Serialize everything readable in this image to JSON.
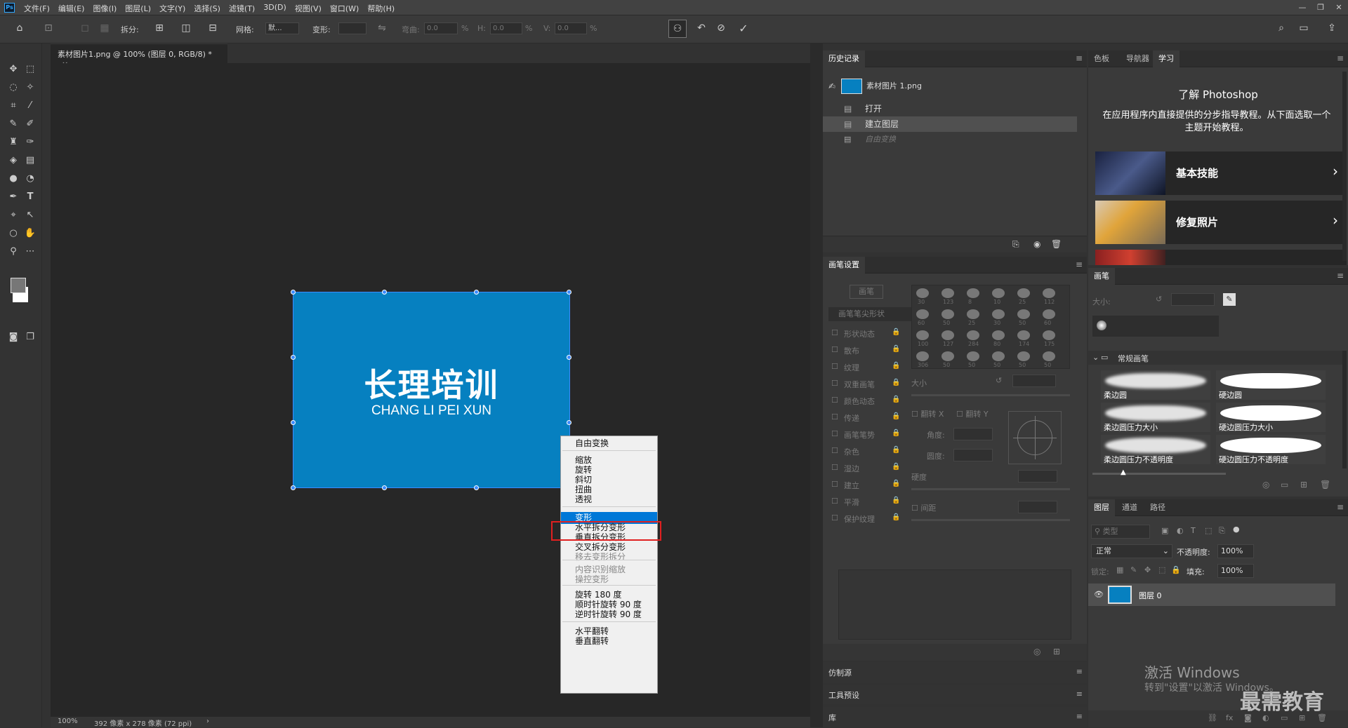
{
  "app": {
    "logo": "Ps"
  },
  "menubar": {
    "items": [
      "文件(F)",
      "编辑(E)",
      "图像(I)",
      "图层(L)",
      "文字(Y)",
      "选择(S)",
      "滤镜(T)",
      "3D(D)",
      "视图(V)",
      "窗口(W)",
      "帮助(H)"
    ],
    "window_controls": [
      "—",
      "❐",
      "✕"
    ]
  },
  "options": {
    "split_label": "拆分:",
    "grid_label": "网格:",
    "grid_value": "默...",
    "warp_label": "变形:",
    "bend_label": "弯曲:",
    "bend_value": "0.0",
    "bend_unit": "%",
    "h_label": "H:",
    "h_value": "0.0",
    "h_unit": "%",
    "v_label": "V:",
    "v_value": "0.0",
    "v_unit": "%"
  },
  "document": {
    "tab_title": "素材图片1.png @ 100% (图层 0, RGB/8) *",
    "tab_close": "×",
    "zoom": "100%",
    "doc_info": "392 像素 x 278 像素 (72 ppi)",
    "status_arrow": "›"
  },
  "artwork": {
    "headline": "长理培训",
    "subtitle": "CHANG LI PEI XUN",
    "color": "#0680c0"
  },
  "context_menu": {
    "items": [
      {
        "label": "自由变换",
        "disabled": false
      },
      {
        "label": "缩放",
        "disabled": false
      },
      {
        "label": "旋转",
        "disabled": false
      },
      {
        "label": "斜切",
        "disabled": false
      },
      {
        "label": "扭曲",
        "disabled": false
      },
      {
        "label": "透视",
        "disabled": false
      },
      {
        "label": "变形",
        "disabled": false,
        "selected": true
      },
      {
        "label": "水平拆分变形",
        "disabled": false
      },
      {
        "label": "垂直拆分变形",
        "disabled": false
      },
      {
        "label": "交叉拆分变形",
        "disabled": false
      },
      {
        "label": "移去变形拆分",
        "disabled": true
      },
      {
        "label": "内容识别缩放",
        "disabled": true
      },
      {
        "label": "操控变形",
        "disabled": true
      },
      {
        "label": "旋转 180 度",
        "disabled": false
      },
      {
        "label": "顺时针旋转 90 度",
        "disabled": false
      },
      {
        "label": "逆时针旋转 90 度",
        "disabled": false
      },
      {
        "label": "水平翻转",
        "disabled": false
      },
      {
        "label": "垂直翻转",
        "disabled": false
      }
    ]
  },
  "history": {
    "title": "历史记录",
    "snapshot": "素材图片 1.png",
    "items": [
      {
        "label": "打开",
        "active": false
      },
      {
        "label": "建立图层",
        "active": true
      },
      {
        "label": "自由变换",
        "active": false,
        "dimmed": true
      }
    ]
  },
  "brush_settings": {
    "title": "画笔设置",
    "brush_button": "画笔",
    "tip_shape": "画笔笔尖形状",
    "options": [
      "形状动态",
      "散布",
      "纹理",
      "双重画笔",
      "颜色动态",
      "传递",
      "画笔笔势",
      "杂色",
      "湿边",
      "建立",
      "平滑",
      "保护纹理"
    ],
    "tip_sizes": [
      "30",
      "123",
      "8",
      "10",
      "25",
      "112",
      "60",
      "50",
      "25",
      "30",
      "50",
      "60",
      "100",
      "127",
      "284",
      "80",
      "174",
      "175",
      "306",
      "50",
      "50",
      "50",
      "50",
      "50"
    ],
    "size_label": "大小",
    "flip_x": "翻转 X",
    "flip_y": "翻转 Y",
    "angle_label": "角度:",
    "roundness_label": "圆度:",
    "hardness_label": "硬度",
    "spacing_label": "间距"
  },
  "clone_source": {
    "title": "仿制源"
  },
  "tool_presets": {
    "title": "工具预设"
  },
  "library": {
    "title": "库"
  },
  "learn_panel": {
    "tabs": [
      "色板",
      "导航器",
      "学习"
    ],
    "active_tab": "学习",
    "heading": "了解 Photoshop",
    "description": "在应用程序内直接提供的分步指导教程。从下面选取一个主题开始教程。",
    "cards": [
      "基本技能",
      "修复照片"
    ]
  },
  "brushes_panel": {
    "title": "画笔",
    "size_label": "大小:",
    "group_name": "常规画笔",
    "brushes": [
      "柔边圆",
      "硬边圆",
      "柔边圆压力大小",
      "硬边圆压力大小",
      "柔边圆压力不透明度",
      "硬边圆压力不透明度"
    ]
  },
  "layers_panel": {
    "tabs": [
      "图层",
      "通道",
      "路径"
    ],
    "active_tab": "图层",
    "filter_placeholder": "类型",
    "blend_mode": "正常",
    "opacity_label": "不透明度:",
    "opacity_value": "100%",
    "lock_label": "锁定:",
    "fill_label": "填充:",
    "fill_value": "100%",
    "layers": [
      {
        "name": "图层 0",
        "visible": true
      }
    ]
  },
  "watermark": {
    "activate_title": "激活 Windows",
    "activate_sub": "转到\"设置\"以激活 Windows。",
    "brand": "最需教育"
  }
}
